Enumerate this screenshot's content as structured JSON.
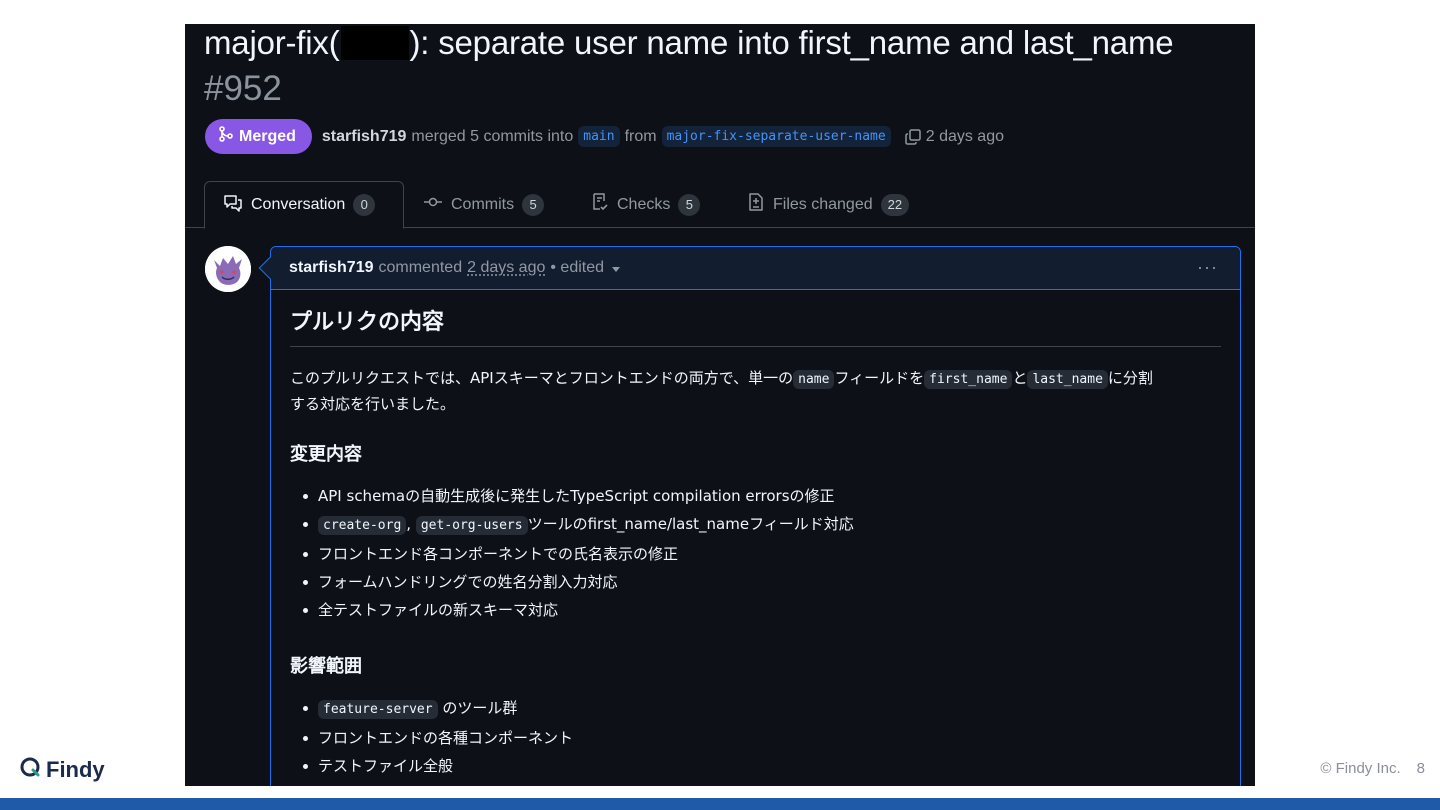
{
  "pr": {
    "title_prefix": "major-fix(",
    "title_suffix": "): separate user name into first_name and last_name",
    "number": "#952",
    "status": "Merged",
    "author": "starfish719",
    "merged_text": "merged 5 commits into",
    "base_branch": "main",
    "from_text": "from",
    "head_branch": "major-fix-separate-user-name",
    "time": "2 days ago"
  },
  "tabs": [
    {
      "label": "Conversation",
      "count": "0"
    },
    {
      "label": "Commits",
      "count": "5"
    },
    {
      "label": "Checks",
      "count": "5"
    },
    {
      "label": "Files changed",
      "count": "22"
    }
  ],
  "comment": {
    "author": "starfish719",
    "action": "commented",
    "time": "2 days ago",
    "edited": "• edited",
    "menu": "···",
    "heading": "プルリクの内容",
    "intro_1": "このプルリクエストでは、APIスキーマとフロントエンドの両方で、単一の",
    "code_name": "name",
    "intro_2": "フィールドを",
    "code_first": "first_name",
    "intro_3": "と",
    "code_last": "last_name",
    "intro_4": "に分割",
    "intro_5": "する対応を行いました。",
    "changes_heading": "変更内容",
    "changes": {
      "item1": "API schemaの自動生成後に発生したTypeScript compilation errorsの修正",
      "item2_code_a": "create-org",
      "item2_sep": ",",
      "item2_code_b": "get-org-users",
      "item2_text": "ツールのfirst_name/last_nameフィールド対応",
      "item3": "フロントエンド各コンポーネントでの氏名表示の修正",
      "item4": "フォームハンドリングでの姓名分割入力対応",
      "item5": "全テストファイルの新スキーマ対応"
    },
    "impact_heading": "影響範囲",
    "impact": {
      "item1_code": "feature-server",
      "item1_text": "のツール群",
      "item2": "フロントエンドの各種コンポーネント",
      "item3": "テストファイル全般"
    }
  },
  "footer": {
    "logo": "Findy",
    "copyright": "© Findy Inc.",
    "page": "8"
  },
  "colors": {
    "background": "#0d1117",
    "merged": "#8957e5",
    "link": "#4493f8",
    "brand_bar": "#1e5aa8"
  }
}
